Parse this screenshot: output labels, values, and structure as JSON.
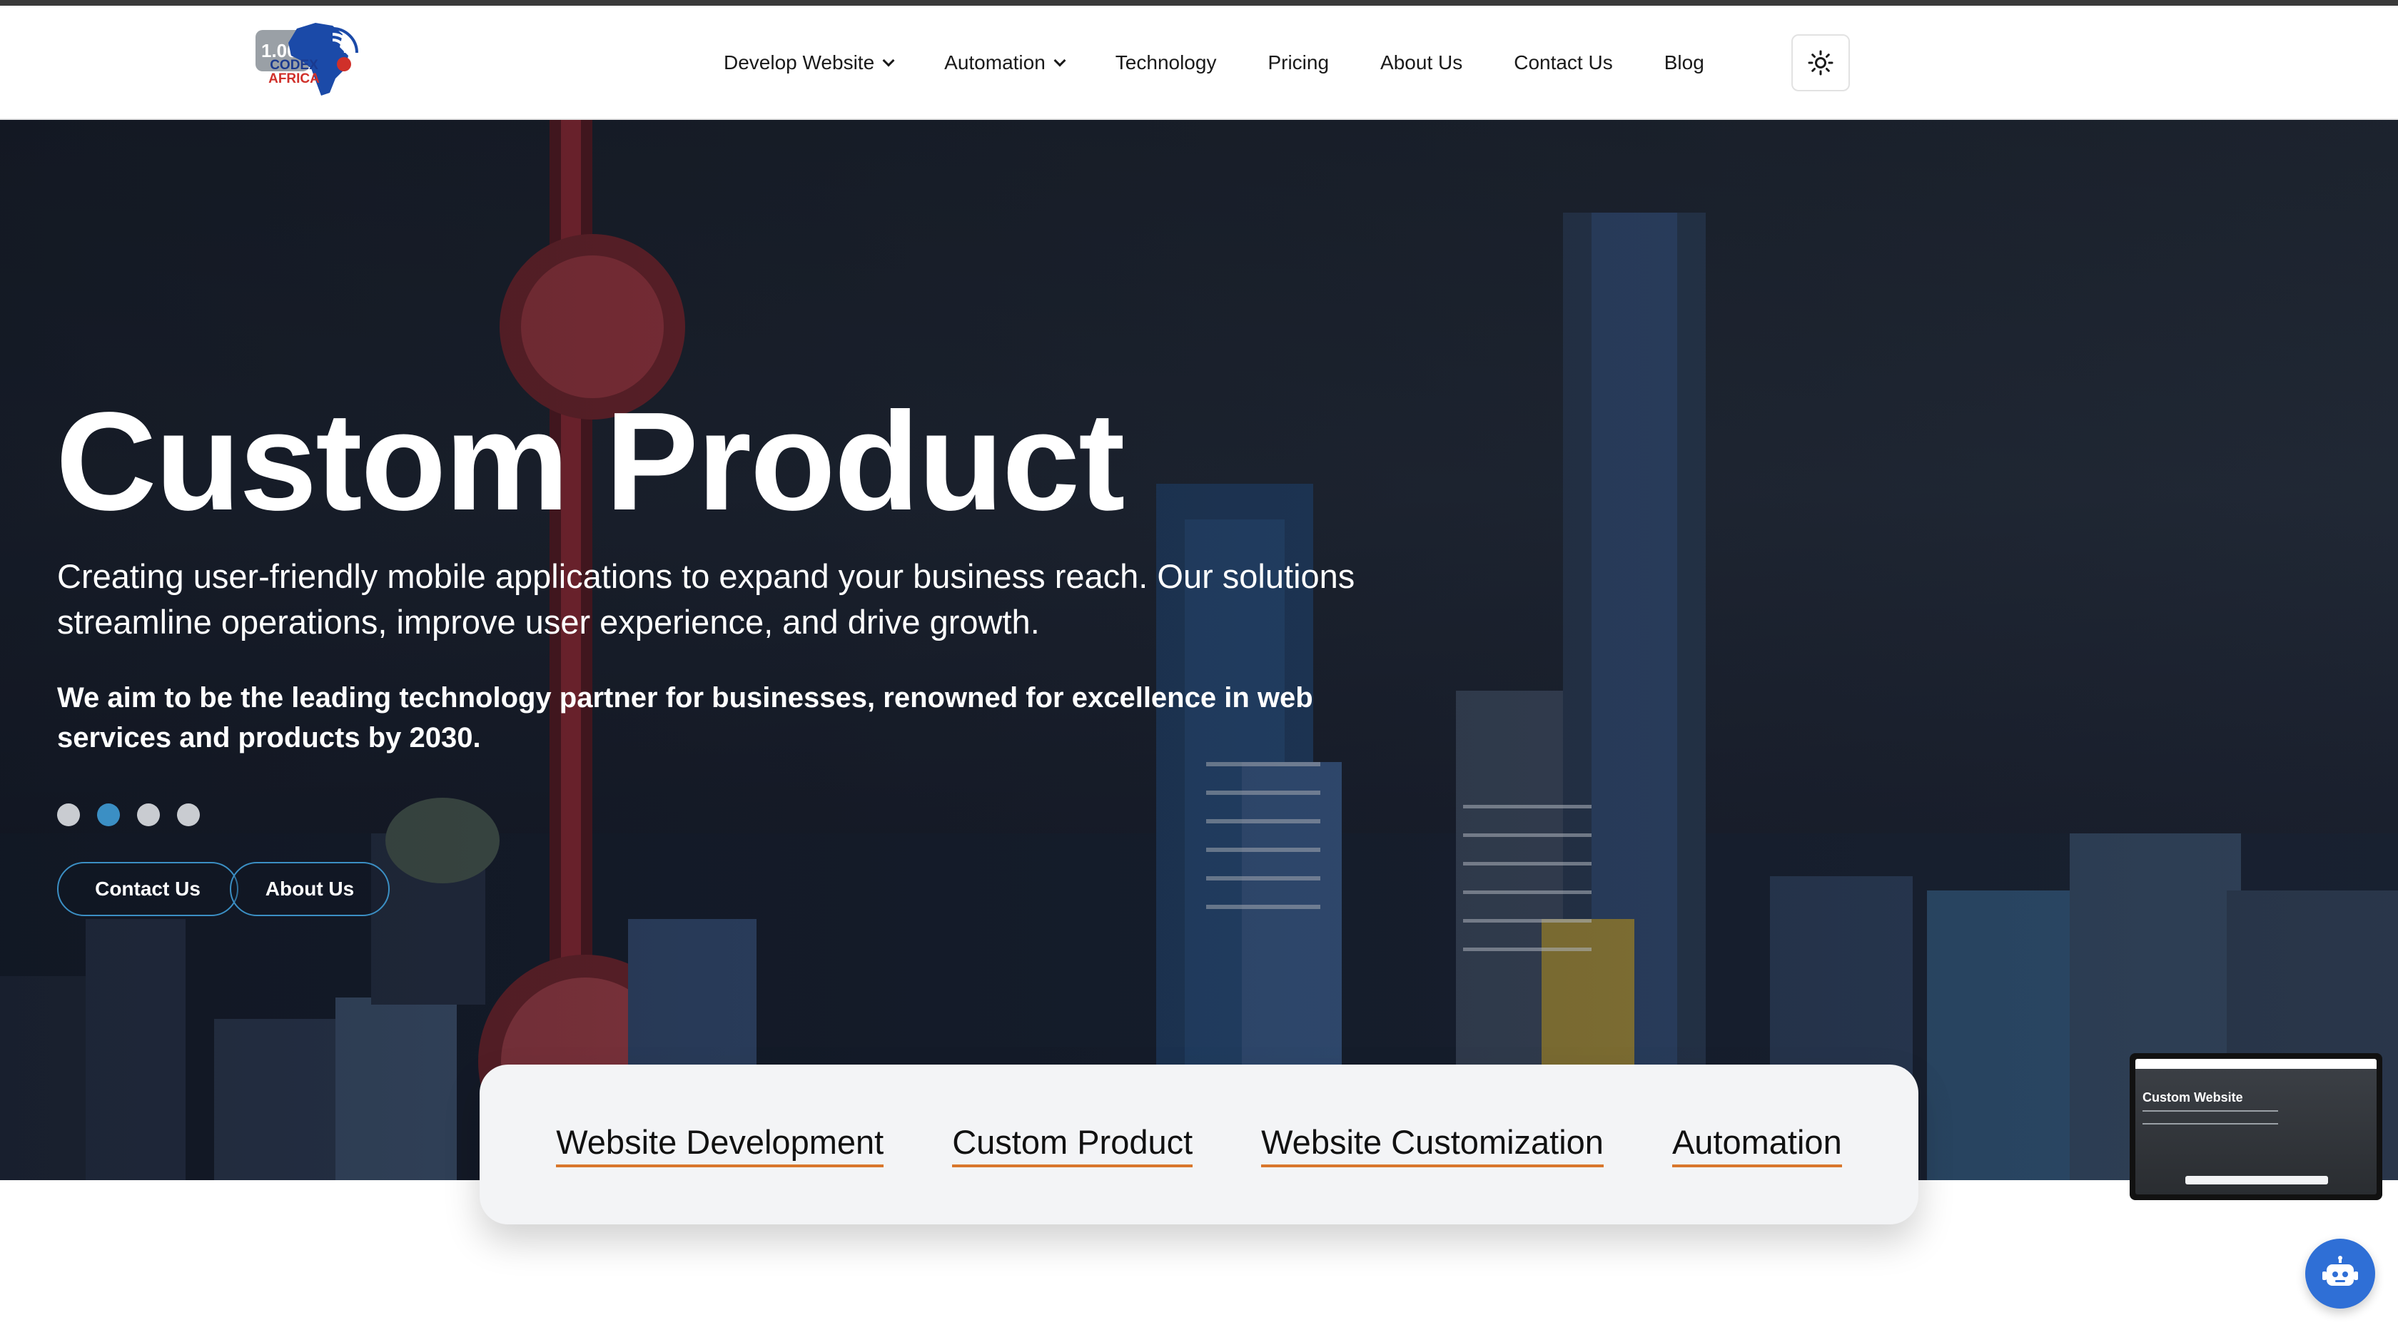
{
  "logo": {
    "version": "1.00",
    "brand_line1": "CODEX",
    "brand_line2": "AFRICA"
  },
  "nav": {
    "items": [
      {
        "label": "Develop Website",
        "dropdown": true
      },
      {
        "label": "Automation",
        "dropdown": true
      },
      {
        "label": "Technology",
        "dropdown": false
      },
      {
        "label": "Pricing",
        "dropdown": false
      },
      {
        "label": "About Us",
        "dropdown": false
      },
      {
        "label": "Contact Us",
        "dropdown": false
      },
      {
        "label": "Blog",
        "dropdown": false
      }
    ],
    "theme_toggle_icon": "sun-icon"
  },
  "hero": {
    "title": "Custom Product",
    "subtitle": "Creating user-friendly mobile applications to expand your business reach. Our solutions streamline operations, improve user experience, and drive growth.",
    "vision": "We aim to be the leading technology partner for businesses, renowned for excellence in web services and products by 2030.",
    "slides_total": 4,
    "active_slide": 2,
    "buttons": {
      "contact": "Contact Us",
      "about": "About Us"
    }
  },
  "services": [
    "Website Development",
    "Custom Product",
    "Website Customization",
    "Automation"
  ],
  "preview": {
    "title": "Custom Website"
  },
  "colors": {
    "accent_blue": "#3b8fc4",
    "underline_orange": "#d9772c",
    "chatbot_blue": "#2f6fd6"
  }
}
